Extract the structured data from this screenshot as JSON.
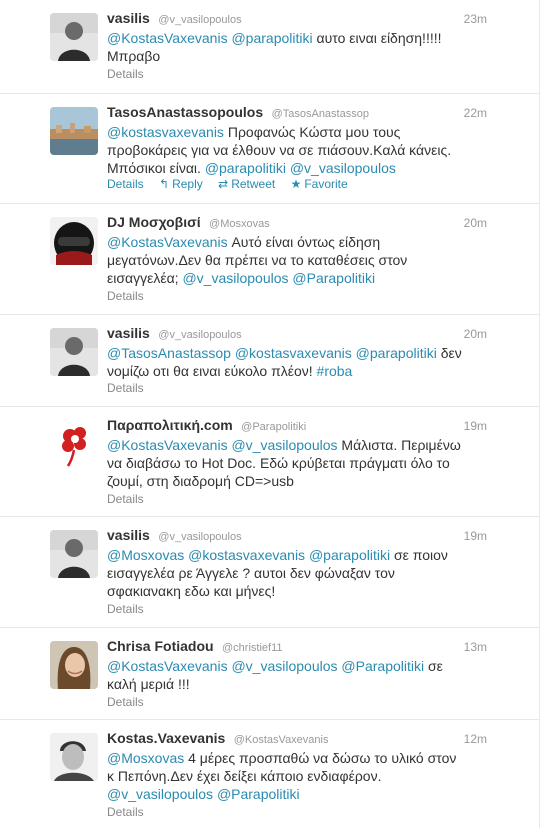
{
  "tweets": [
    {
      "fullname": "vasilis",
      "username": "@v_vasilopoulos",
      "time": "23m",
      "segments": [
        {
          "t": "m",
          "v": "@KostasVaxevanis"
        },
        {
          "t": "s",
          "v": " "
        },
        {
          "t": "m",
          "v": "@parapolitiki"
        },
        {
          "t": "s",
          "v": " αυτο ειναι είδηση!!!!! Μπραβο"
        }
      ],
      "details": "Details",
      "avatar": "person-gray"
    },
    {
      "fullname": "TasosAnastassopoulos",
      "username": "@TasosAnastassop",
      "time": "22m",
      "segments": [
        {
          "t": "m",
          "v": "@kostasvaxevanis"
        },
        {
          "t": "s",
          "v": " Προφανώς Κώστα μου τους προβοκάρεις για να έλθουν να σε πιάσουν.Καλά κάνεις. Μπόσικοι είναι. "
        },
        {
          "t": "m",
          "v": "@parapolitiki"
        },
        {
          "t": "s",
          "v": " "
        },
        {
          "t": "m",
          "v": "@v_vasilopoulos"
        }
      ],
      "details": "Details",
      "reply": "Reply",
      "retweet": "Retweet",
      "favorite": "Favorite",
      "avatar": "landscape"
    },
    {
      "fullname": "DJ Μοσχοβισί",
      "username": "@Mosxovas",
      "time": "20m",
      "segments": [
        {
          "t": "m",
          "v": "@KostasVaxevanis"
        },
        {
          "t": "s",
          "v": " Αυτό είναι όντως είδηση μεγατόνων.Δεν θα πρέπει να το καταθέσεις στον εισαγγελέα; "
        },
        {
          "t": "m",
          "v": "@v_vasilopoulos"
        },
        {
          "t": "s",
          "v": " "
        },
        {
          "t": "m",
          "v": "@Parapolitiki"
        }
      ],
      "details": "Details",
      "avatar": "helmet"
    },
    {
      "fullname": "vasilis",
      "username": "@v_vasilopoulos",
      "time": "20m",
      "segments": [
        {
          "t": "m",
          "v": "@TasosAnastassop"
        },
        {
          "t": "s",
          "v": " "
        },
        {
          "t": "m",
          "v": "@kostasvaxevanis"
        },
        {
          "t": "s",
          "v": " "
        },
        {
          "t": "m",
          "v": "@parapolitiki"
        },
        {
          "t": "s",
          "v": " δεν νομίζω οτι θα ειναι εύκολο πλέον! "
        },
        {
          "t": "h",
          "v": "#roba"
        }
      ],
      "details": "Details",
      "avatar": "person-gray"
    },
    {
      "fullname": "Παραπολιτική.com",
      "username": "@Parapolitiki",
      "time": "19m",
      "segments": [
        {
          "t": "m",
          "v": "@KostasVaxevanis"
        },
        {
          "t": "s",
          "v": " "
        },
        {
          "t": "m",
          "v": "@v_vasilopoulos"
        },
        {
          "t": "s",
          "v": " Μάλιστα. Περιμένω να διαβάσω το Hot Doc. Εδώ κρύβεται πράγματι όλο το ζουμί, στη διαδρομή CD=>usb"
        }
      ],
      "details": "Details",
      "avatar": "flower"
    },
    {
      "fullname": "vasilis",
      "username": "@v_vasilopoulos",
      "time": "19m",
      "segments": [
        {
          "t": "m",
          "v": "@Mosxovas"
        },
        {
          "t": "s",
          "v": " "
        },
        {
          "t": "m",
          "v": "@kostasvaxevanis"
        },
        {
          "t": "s",
          "v": " "
        },
        {
          "t": "m",
          "v": "@parapolitiki"
        },
        {
          "t": "s",
          "v": " σε ποιον εισαγγελέα ρε Άγγελε ? αυτοι δεν φώναξαν τον σφακιανακη εδω και μήνες!"
        }
      ],
      "details": "Details",
      "avatar": "person-gray"
    },
    {
      "fullname": "Chrisa Fotiadou",
      "username": "@christief11",
      "time": "13m",
      "segments": [
        {
          "t": "m",
          "v": "@KostasVaxevanis"
        },
        {
          "t": "s",
          "v": " "
        },
        {
          "t": "m",
          "v": "@v_vasilopoulos"
        },
        {
          "t": "s",
          "v": " "
        },
        {
          "t": "m",
          "v": "@Parapolitiki"
        },
        {
          "t": "s",
          "v": " σε καλή μεριά !!!"
        }
      ],
      "details": "Details",
      "avatar": "woman"
    },
    {
      "fullname": "Kostas.Vaxevanis",
      "username": "@KostasVaxevanis",
      "time": "12m",
      "segments": [
        {
          "t": "m",
          "v": "@Mosxovas"
        },
        {
          "t": "s",
          "v": " 4 μέρες προσπαθώ να δώσω το υλικό στον κ Πεπόνη.Δεν έχει δείξει κάποιο ενδιαφέρον. "
        },
        {
          "t": "m",
          "v": "@v_vasilopoulos"
        },
        {
          "t": "s",
          "v": " "
        },
        {
          "t": "m",
          "v": "@Parapolitiki"
        }
      ],
      "details": "Details",
      "avatar": "man-bw"
    }
  ]
}
